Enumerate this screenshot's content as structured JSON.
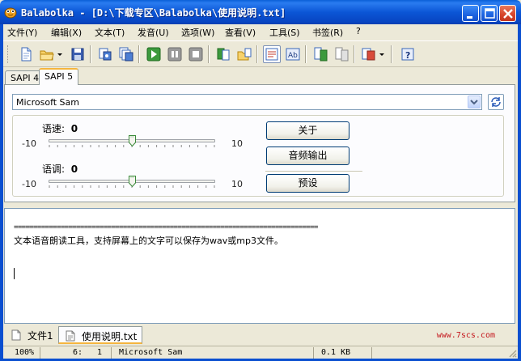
{
  "window": {
    "title": "Balabolka - [D:\\下载专区\\Balabolka\\使用说明.txt]"
  },
  "menu": {
    "items": [
      "文件(Y)",
      "编辑(X)",
      "文本(T)",
      "发音(U)",
      "选项(W)",
      "查看(V)",
      "工具(S)",
      "书签(R)",
      "?"
    ]
  },
  "toolbar": {
    "icons": [
      "new-document-icon",
      "open-folder-icon",
      "save-icon",
      "convert-icon",
      "batch-convert-icon",
      "play-icon",
      "pause-icon",
      "stop-icon",
      "read-clipboard-icon",
      "open-clipboard-icon",
      "text-view-icon",
      "spell-icon",
      "split-icon",
      "join-icon",
      "bookmark-icon",
      "help-icon"
    ]
  },
  "sapi_tabs": [
    "SAPI 4",
    "SAPI 5"
  ],
  "voice": {
    "selected": "Microsoft Sam"
  },
  "rate": {
    "label": "语速:",
    "value": "0",
    "min": "-10",
    "max": "10",
    "level": 0.5
  },
  "pitch": {
    "label": "语调:",
    "value": "0",
    "min": "-10",
    "max": "10",
    "level": 0.5
  },
  "buttons": {
    "about": "关于",
    "audio_output": "音频输出",
    "preset": "预设"
  },
  "editor": {
    "separator": "==============================================================================",
    "text": "文本语音朗读工具，支持屏幕上的文字可以保存为wav或mp3文件。"
  },
  "doc_tabs": [
    "文件1",
    "使用说明.txt"
  ],
  "watermark": "www.7scs.com",
  "status": {
    "zoom": "100%",
    "line": "6:",
    "col": "1",
    "voice": "Microsoft Sam",
    "size": "0.1 KB"
  },
  "colors": {
    "titlebar": "#0b56d6",
    "active_tab_accent": "#f5b53e",
    "watermark": "#c4161c"
  }
}
